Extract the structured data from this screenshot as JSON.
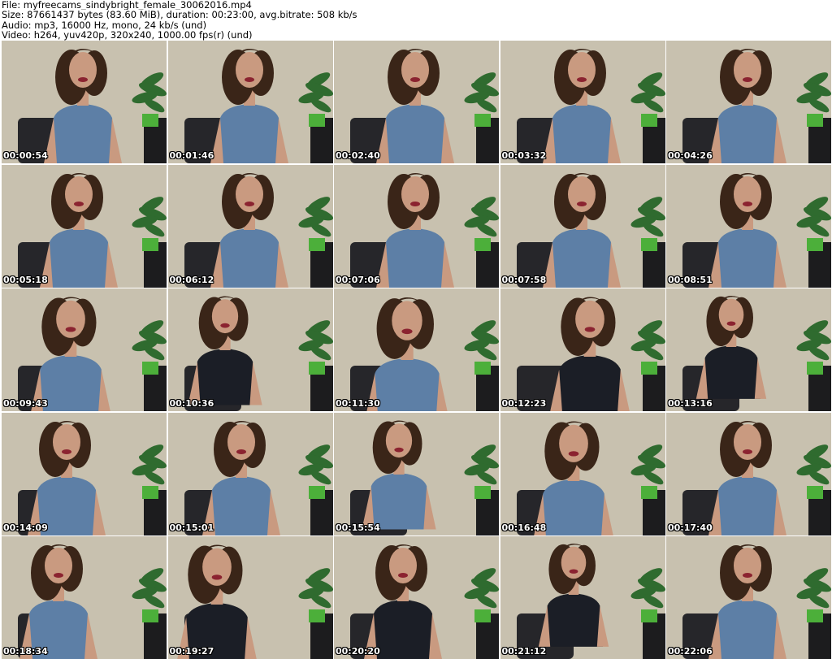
{
  "header": {
    "file_line": "File: myfreecams_sindybright_female_30062016.mp4",
    "size_line": "Size: 87661437 bytes (83.60 MiB), duration: 00:23:00, avg.bitrate: 508 kb/s",
    "audio_line": "Audio: mp3, 16000 Hz, mono, 24 kb/s (und)",
    "video_line": "Video: h264, yuv420p, 320x240, 1000.00 fps(r) (und)"
  },
  "thumbnails": [
    {
      "timestamp": "00:00:54"
    },
    {
      "timestamp": "00:01:46"
    },
    {
      "timestamp": "00:02:40"
    },
    {
      "timestamp": "00:03:32"
    },
    {
      "timestamp": "00:04:26"
    },
    {
      "timestamp": "00:05:18"
    },
    {
      "timestamp": "00:06:12"
    },
    {
      "timestamp": "00:07:06"
    },
    {
      "timestamp": "00:07:58"
    },
    {
      "timestamp": "00:08:51"
    },
    {
      "timestamp": "00:09:43"
    },
    {
      "timestamp": "00:10:36"
    },
    {
      "timestamp": "00:11:30"
    },
    {
      "timestamp": "00:12:23"
    },
    {
      "timestamp": "00:13:16"
    },
    {
      "timestamp": "00:14:09"
    },
    {
      "timestamp": "00:15:01"
    },
    {
      "timestamp": "00:15:54"
    },
    {
      "timestamp": "00:16:48"
    },
    {
      "timestamp": "00:17:40"
    },
    {
      "timestamp": "00:18:34"
    },
    {
      "timestamp": "00:19:27"
    },
    {
      "timestamp": "00:20:20"
    },
    {
      "timestamp": "00:21:12"
    },
    {
      "timestamp": "00:22:06"
    }
  ],
  "colors": {
    "wall": "#cdc6b4",
    "sofa": "#26262a",
    "plant_leaf": "#2f6b2f",
    "plant_pot": "#4caf3a",
    "shelf": "#1c1c1e",
    "hair": "#3a2518",
    "skin": "#c99a80",
    "denim": "#5d7fa6",
    "black_top": "#1b1e26",
    "shorts": "#8eb0d0"
  }
}
